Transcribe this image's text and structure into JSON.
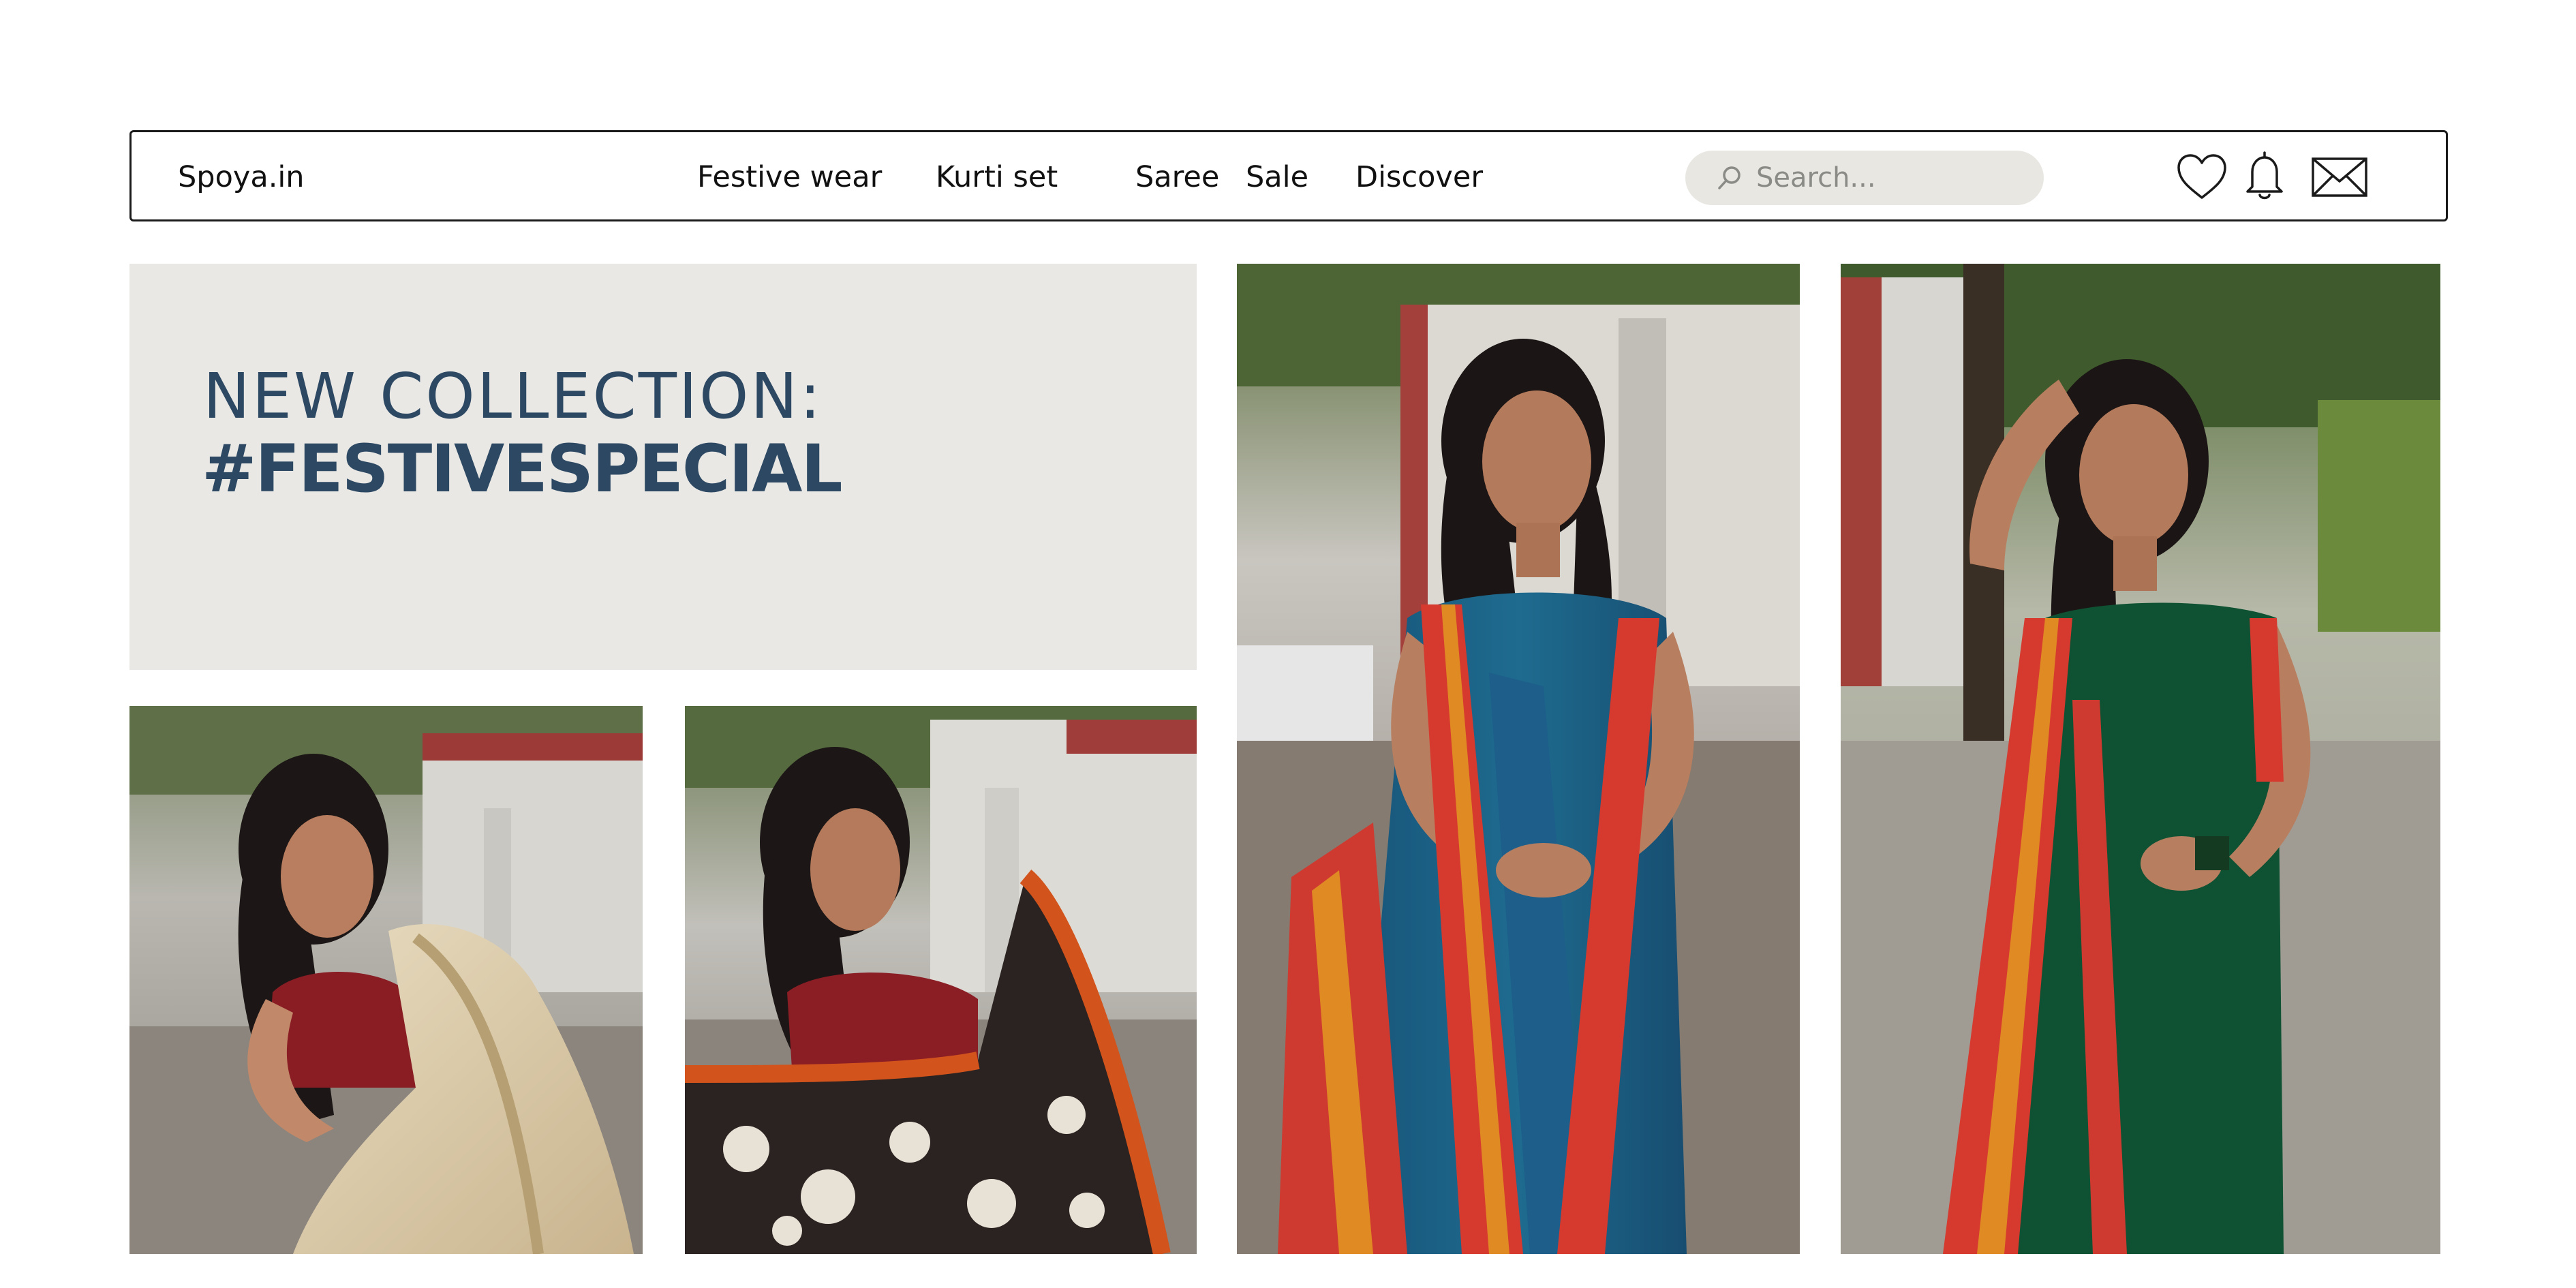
{
  "header": {
    "brand": "Spoya.in",
    "nav": [
      {
        "label": "Festive wear"
      },
      {
        "label": "Kurti set"
      },
      {
        "label": "Saree"
      },
      {
        "label": "Sale"
      },
      {
        "label": "Discover"
      }
    ],
    "search": {
      "placeholder": "Search...",
      "icon": "search-icon"
    },
    "actions": [
      {
        "icon": "heart-icon"
      },
      {
        "icon": "bell-icon"
      },
      {
        "icon": "mail-icon"
      }
    ]
  },
  "banner": {
    "line1": "NEW COLLECTION:",
    "line2": "#FESTIVESPECIAL"
  },
  "colors": {
    "accent": "#2d4863",
    "banner_bg": "#e9e8e4",
    "search_bg": "#e9e7e2"
  },
  "products": [
    {
      "image": "model-beige-dupatta-maroon-blouse"
    },
    {
      "image": "model-maroon-blouse-black-floral-dupatta"
    },
    {
      "image": "model-teal-blue-dress-red-orange-dupatta"
    },
    {
      "image": "model-green-dress-red-orange-dupatta"
    }
  ]
}
